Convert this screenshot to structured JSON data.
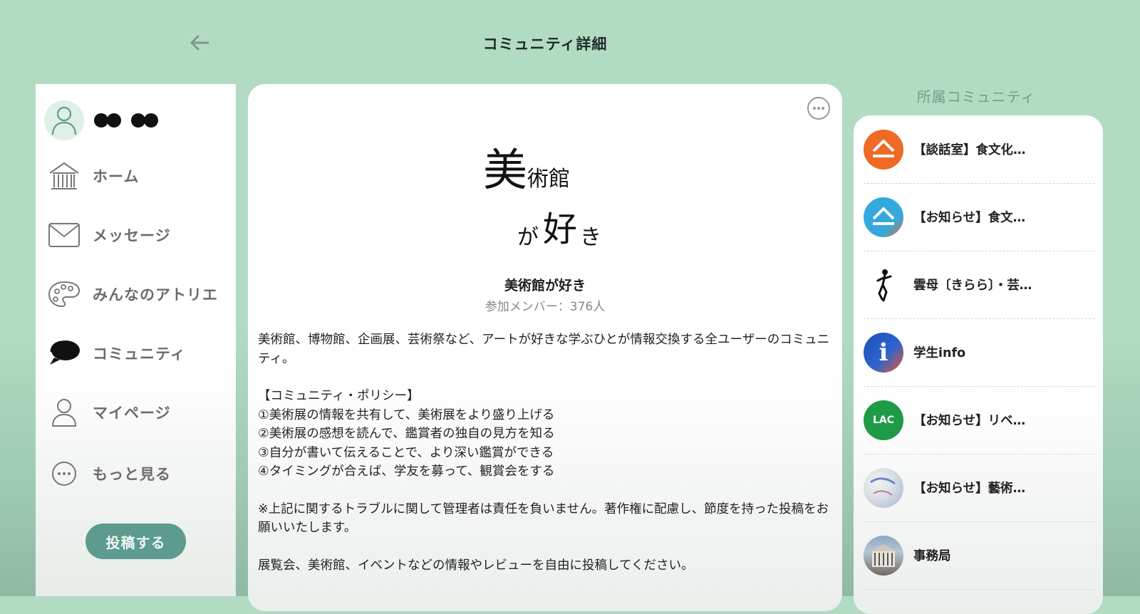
{
  "header": {
    "title": "コミュニティ詳細",
    "back_icon": "arrow-left-icon"
  },
  "sidebar": {
    "user_name": "●● ●●",
    "items": [
      {
        "label": "ホーム",
        "icon": "home-icon"
      },
      {
        "label": "メッセージ",
        "icon": "mail-icon"
      },
      {
        "label": "みんなのアトリエ",
        "icon": "palette-icon"
      },
      {
        "label": "コミュニティ",
        "icon": "chat-bubbles-icon"
      },
      {
        "label": "マイページ",
        "icon": "person-icon"
      },
      {
        "label": "もっと見る",
        "icon": "more-horizontal-icon"
      }
    ],
    "post_button": "投稿する"
  },
  "main": {
    "logo": {
      "part1": "美",
      "part2": "術館",
      "part3": "が",
      "part4": "好",
      "part5": "き"
    },
    "community_name": "美術館が好き",
    "member_count": "参加メンバー：376人",
    "description": [
      "美術館、博物館、企画展、芸術祭など、アートが好きな学ぶひとが情報交換する全ユーザーのコミュニティ。",
      "【コミュニティ・ポリシー】",
      "①美術展の情報を共有して、美術展をより盛り上げる",
      "②美術展の感想を読んで、鑑賞者の独自の見方を知る",
      "③自分が書いて伝えることで、より深い鑑賞ができる",
      "④タイミングが合えば、学友を募って、観賞会をする",
      "※上記に関するトラブルに関して管理者は責任を負いません。著作権に配慮し、節度を持った投稿をお願いいたします。",
      "展覧会、美術館、イベントなどの情報やレビューを自由に投稿してください。"
    ]
  },
  "right": {
    "title": "所属コミュニティ",
    "communities": [
      {
        "label": "【談話室】食文化…",
        "icon": "orange-house-logo-icon"
      },
      {
        "label": "【お知らせ】食文…",
        "icon": "blue-house-logo-icon"
      },
      {
        "label": "雲母〔きらら〕・芸…",
        "icon": "figure-drawing-icon"
      },
      {
        "label": "学生info",
        "icon": "info-icon",
        "badge": "i"
      },
      {
        "label": "【お知らせ】リベ…",
        "icon": "lac-logo-icon",
        "badge": "LAC"
      },
      {
        "label": "【お知らせ】藝術…",
        "icon": "art-photo-icon"
      },
      {
        "label": "事務局",
        "icon": "building-photo-icon"
      }
    ]
  }
}
